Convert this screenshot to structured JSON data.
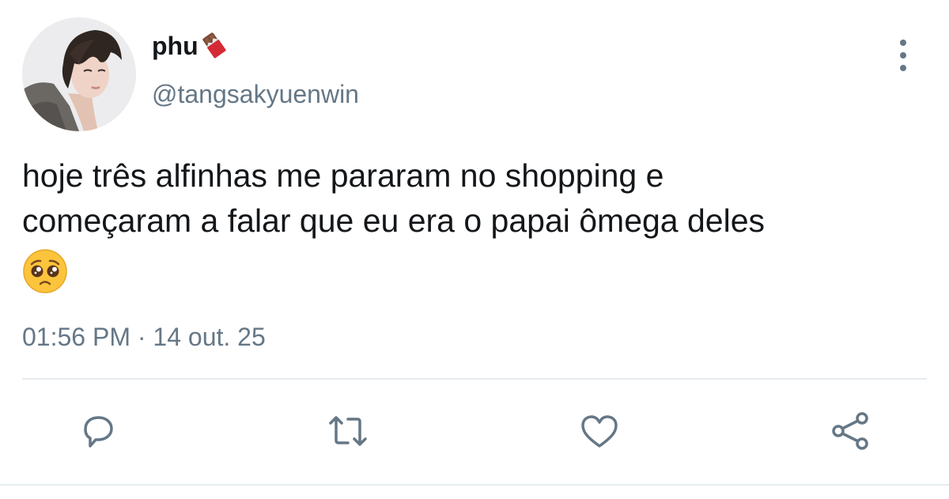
{
  "author": {
    "display_name": "phu",
    "badge_emoji": "chocolate-bar-icon",
    "handle": "@tangsakyuenwin"
  },
  "tweet": {
    "text_lines": [
      "hoje três alfinhas me pararam no shopping e",
      "começaram a falar que eu era o papai ômega deles"
    ],
    "trailing_emoji": "pleading-face-icon",
    "time": "01:56 PM",
    "separator": "·",
    "date": "14 out. 25"
  },
  "actions": [
    "reply-icon",
    "retweet-icon",
    "like-icon",
    "share-icon"
  ],
  "colors": {
    "text": "#14171a",
    "secondary": "#657786",
    "divider": "#e6ecf0"
  }
}
